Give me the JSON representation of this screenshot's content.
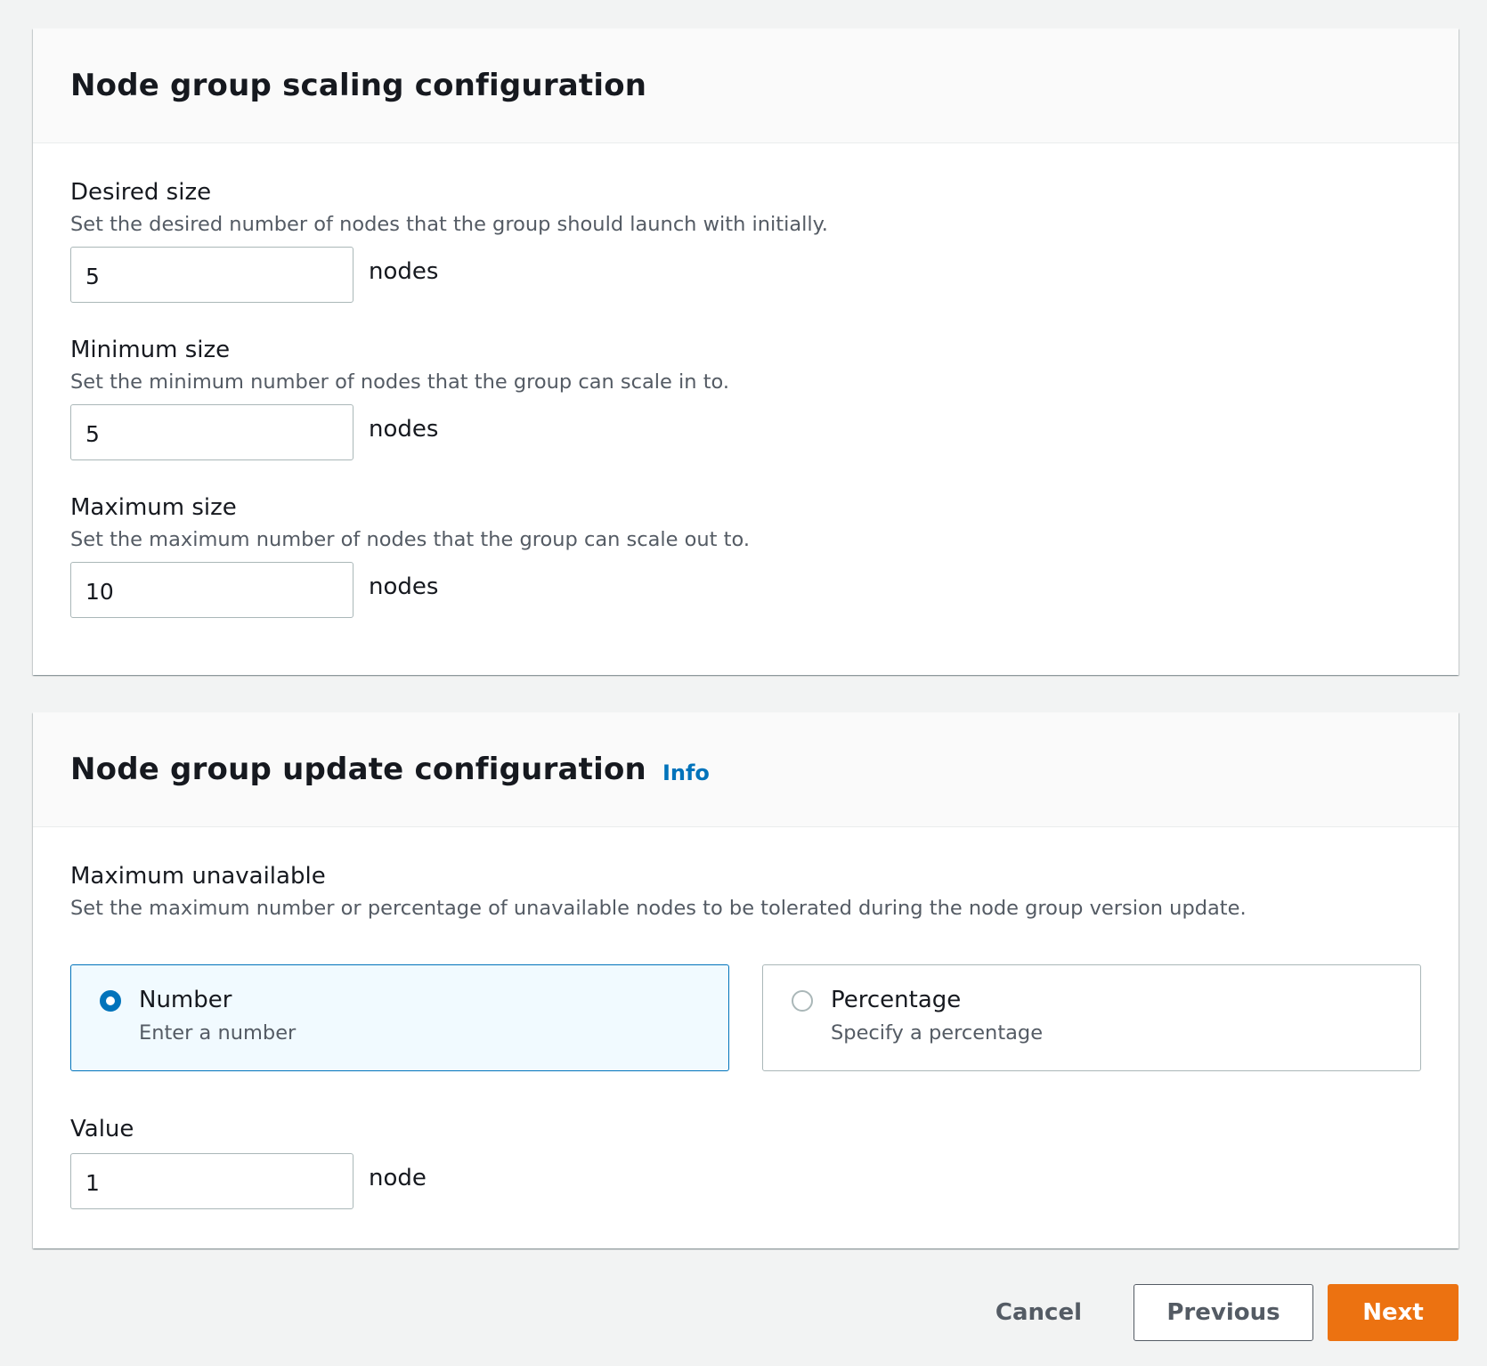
{
  "scaling": {
    "title": "Node group scaling configuration",
    "desired": {
      "label": "Desired size",
      "description": "Set the desired number of nodes that the group should launch with initially.",
      "value": "5",
      "unit": "nodes"
    },
    "minimum": {
      "label": "Minimum size",
      "description": "Set the minimum number of nodes that the group can scale in to.",
      "value": "5",
      "unit": "nodes"
    },
    "maximum": {
      "label": "Maximum size",
      "description": "Set the maximum number of nodes that the group can scale out to.",
      "value": "10",
      "unit": "nodes"
    }
  },
  "update": {
    "title": "Node group update configuration",
    "info_label": "Info",
    "max_unavailable": {
      "label": "Maximum unavailable",
      "description": "Set the maximum number or percentage of unavailable nodes to be tolerated during the node group version update."
    },
    "options": [
      {
        "label": "Number",
        "description": "Enter a number",
        "selected": true
      },
      {
        "label": "Percentage",
        "description": "Specify a percentage",
        "selected": false
      }
    ],
    "value_field": {
      "label": "Value",
      "value": "1",
      "unit": "node"
    }
  },
  "actions": {
    "cancel": "Cancel",
    "previous": "Previous",
    "next": "Next"
  },
  "colors": {
    "accent": "#0073bb",
    "primary_button": "#ec7211",
    "selected_tile_bg": "#f1faff"
  }
}
